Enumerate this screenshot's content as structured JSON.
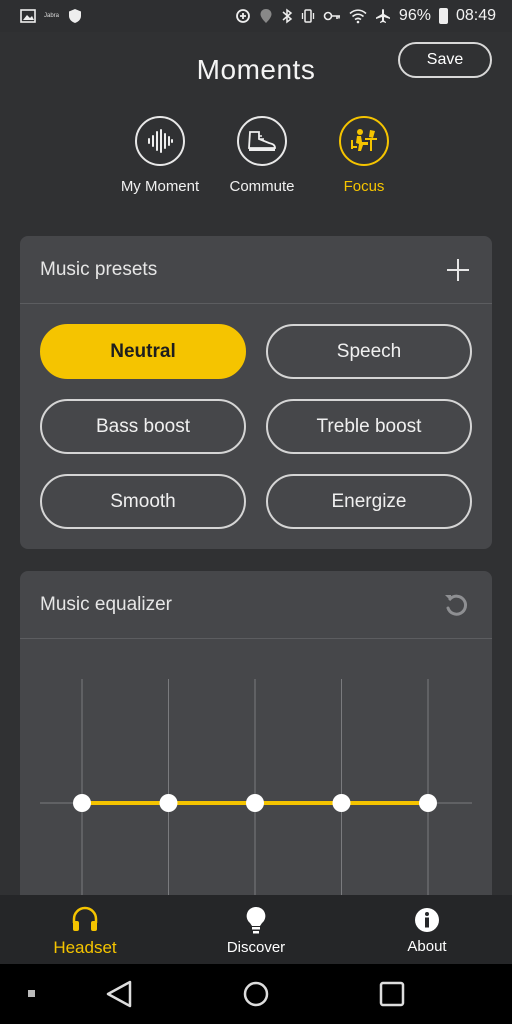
{
  "status_bar": {
    "left_text": "Jabra",
    "battery": "96%",
    "time": "08:49"
  },
  "header": {
    "title": "Moments",
    "save_label": "Save"
  },
  "moments": [
    {
      "label": "My Moment",
      "icon": "soundwave-icon",
      "active": false
    },
    {
      "label": "Commute",
      "icon": "sneaker-icon",
      "active": false
    },
    {
      "label": "Focus",
      "icon": "desk-worker-icon",
      "active": true
    }
  ],
  "presets": {
    "title": "Music presets",
    "add_icon": "plus-icon",
    "items": [
      {
        "label": "Neutral",
        "selected": true
      },
      {
        "label": "Speech",
        "selected": false
      },
      {
        "label": "Bass boost",
        "selected": false
      },
      {
        "label": "Treble boost",
        "selected": false
      },
      {
        "label": "Smooth",
        "selected": false
      },
      {
        "label": "Energize",
        "selected": false
      }
    ]
  },
  "equalizer": {
    "title": "Music equalizer",
    "reset_icon": "reset-icon",
    "band_count": 5,
    "band_levels": [
      0,
      0,
      0,
      0,
      0
    ]
  },
  "bottom_nav": [
    {
      "label": "Headset",
      "icon": "headphones-icon",
      "active": true
    },
    {
      "label": "Discover",
      "icon": "lightbulb-icon",
      "active": false
    },
    {
      "label": "About",
      "icon": "info-icon",
      "active": false
    }
  ],
  "colors": {
    "accent": "#f5c400",
    "background": "#303133",
    "card": "#46474a",
    "nav": "#252628"
  }
}
